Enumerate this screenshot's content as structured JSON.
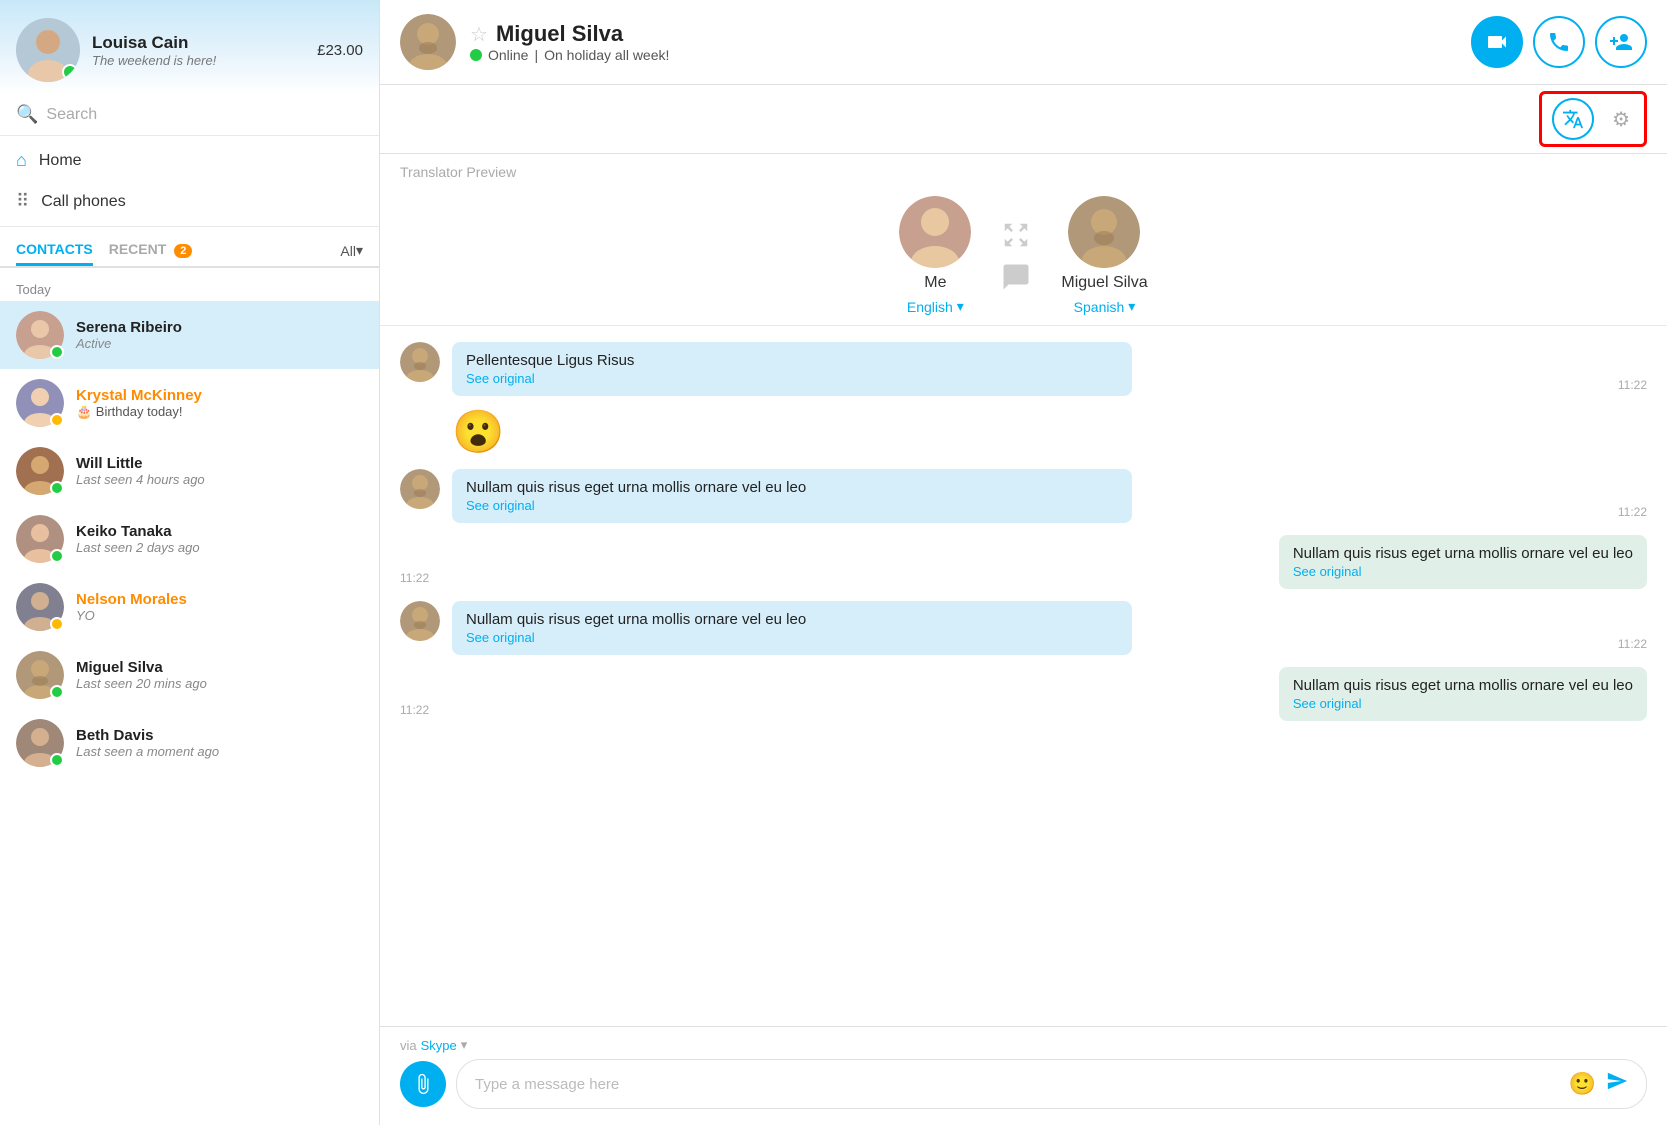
{
  "profile": {
    "name": "Louisa Cain",
    "status": "The weekend is here!",
    "credit": "£23.00",
    "avatar_bg": "#b0c8d8"
  },
  "search": {
    "placeholder": "Search"
  },
  "nav": {
    "home": "Home",
    "call_phones": "Call phones"
  },
  "tabs": {
    "contacts": "CONTACTS",
    "recent": "RECENT",
    "recent_badge": "2",
    "all": "All"
  },
  "contacts_section": "Today",
  "contacts": [
    {
      "name": "Serena Ribeiro",
      "sub": "Active",
      "status": "green",
      "active": true,
      "color": "normal"
    },
    {
      "name": "Krystal McKinney",
      "sub": "Birthday today!",
      "status": "yellow",
      "active": false,
      "color": "orange"
    },
    {
      "name": "Will Little",
      "sub": "Last seen 4 hours ago",
      "status": "green",
      "active": false,
      "color": "normal"
    },
    {
      "name": "Keiko Tanaka",
      "sub": "Last seen 2 days ago",
      "status": "green",
      "active": false,
      "color": "normal"
    },
    {
      "name": "Nelson Morales",
      "sub": "YO",
      "status": "yellow",
      "active": false,
      "color": "orange"
    },
    {
      "name": "Miguel Silva",
      "sub": "Last seen 20 mins ago",
      "status": "green",
      "active": false,
      "color": "normal"
    },
    {
      "name": "Beth Davis",
      "sub": "Last seen a moment ago",
      "status": "green",
      "active": false,
      "color": "normal"
    }
  ],
  "chat": {
    "contact_name": "Miguel Silva",
    "contact_status": "Online",
    "contact_status_extra": "On holiday all week!",
    "translator_preview_label": "Translator Preview",
    "me_label": "Me",
    "me_language": "English",
    "me_lang_arrow": "▾",
    "contact_language": "Spanish",
    "contact_lang_arrow": "▾",
    "via_skype_prefix": "via",
    "via_skype_link": "Skype",
    "via_skype_arrow": "▾",
    "message_placeholder": "Type a message here"
  },
  "messages": [
    {
      "type": "incoming",
      "text": "Pellentesque Ligus Risus",
      "see_original": "See original",
      "time": "11:22"
    },
    {
      "type": "emoji",
      "emoji": "😮"
    },
    {
      "type": "incoming",
      "text": "Nullam quis risus eget urna mollis ornare vel eu leo",
      "see_original": "See original",
      "time": "11:22"
    },
    {
      "type": "outgoing",
      "text": "Nullam quis risus eget urna mollis ornare vel eu leo",
      "see_original": "See original",
      "time": "11:22"
    },
    {
      "type": "incoming",
      "text": "Nullam quis risus eget urna mollis ornare vel eu leo",
      "see_original": "See original",
      "time": "11:22"
    },
    {
      "type": "outgoing",
      "text": "Nullam quis risus eget urna mollis ornare vel eu leo",
      "see_original": "See original",
      "time": "11:22"
    }
  ],
  "action_buttons": {
    "video_call": "video-call",
    "audio_call": "audio-call",
    "add_contact": "add-contact"
  }
}
